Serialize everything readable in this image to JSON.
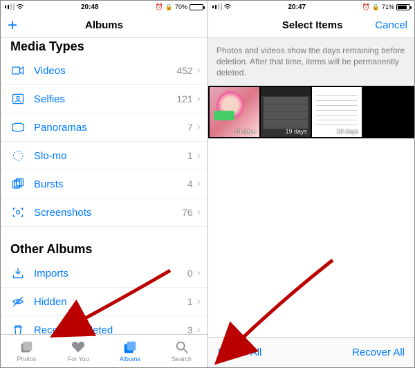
{
  "left": {
    "status": {
      "time": "20:48",
      "alarm": "⏰",
      "battery_text": "70%",
      "battery_fill": "70%"
    },
    "nav": {
      "title": "Albums"
    },
    "section1": "Media Types",
    "media": [
      {
        "icon": "video",
        "label": "Videos",
        "count": "452"
      },
      {
        "icon": "selfie",
        "label": "Selfies",
        "count": "121"
      },
      {
        "icon": "panorama",
        "label": "Panoramas",
        "count": "7"
      },
      {
        "icon": "slomo",
        "label": "Slo-mo",
        "count": "1"
      },
      {
        "icon": "burst",
        "label": "Bursts",
        "count": "4"
      },
      {
        "icon": "screenshot",
        "label": "Screenshots",
        "count": "76"
      }
    ],
    "section2": "Other Albums",
    "other": [
      {
        "icon": "imports",
        "label": "Imports",
        "count": "0"
      },
      {
        "icon": "hidden",
        "label": "Hidden",
        "count": "1"
      },
      {
        "icon": "trash",
        "label": "Recently Deleted",
        "count": "3"
      }
    ],
    "tabs": [
      {
        "label": "Photos"
      },
      {
        "label": "For You"
      },
      {
        "label": "Albums"
      },
      {
        "label": "Search"
      }
    ]
  },
  "right": {
    "status": {
      "time": "20:47",
      "alarm": "⏰",
      "battery_text": "71%",
      "battery_fill": "71%"
    },
    "nav": {
      "title": "Select Items",
      "cancel": "Cancel"
    },
    "banner": "Photos and videos show the days remaining before deletion. After that time, items will be permanently deleted.",
    "thumbs": [
      {
        "days": "19 days"
      },
      {
        "days": "19 days"
      },
      {
        "days": "19 days"
      }
    ],
    "bottom": {
      "delete": "Delete All",
      "recover": "Recover All"
    }
  }
}
